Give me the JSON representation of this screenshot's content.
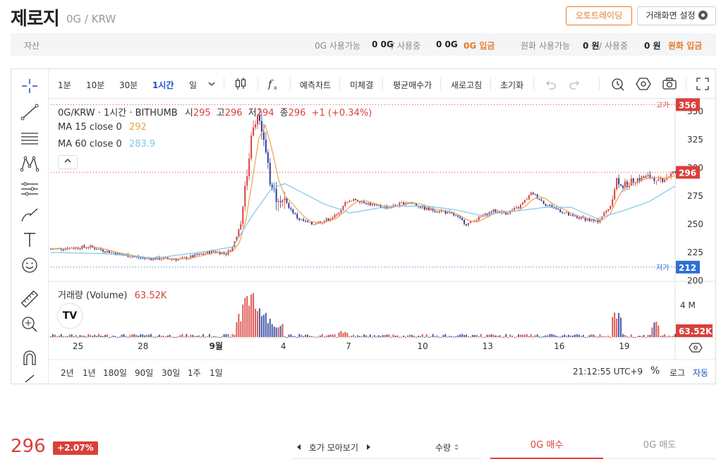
{
  "header": {
    "coin_name": "제로지",
    "pair": "0G / KRW",
    "auto_trading": "오토트레이딩",
    "screen_settings": "거래화면 설정"
  },
  "asset_bar": {
    "label": "자산",
    "coin_available_label": "0G 사용가능",
    "coin_available": "0 0G",
    "in_use_label": "/ 사용중",
    "coin_in_use": "0 0G",
    "deposit_coin": "0G 입금",
    "krw_available_label": "원화 사용가능",
    "krw_available": "0 원",
    "krw_in_use": "0 원",
    "deposit_krw": "원화 입금"
  },
  "toolbar": {
    "intervals": [
      "1분",
      "10분",
      "30분",
      "1시간",
      "일"
    ],
    "active_interval": "1시간",
    "buttons": [
      "예측차트",
      "미체결",
      "평균매수가",
      "새로고침",
      "초기화"
    ]
  },
  "legend": {
    "symbol_line": "0G/KRW · 1시간 · BITHUMB",
    "open_label": "시",
    "open": "295",
    "high_label": "고",
    "high": "296",
    "low_label": "저",
    "low": "294",
    "close_label": "종",
    "close": "296",
    "change": "+1 (+0.34%)",
    "ma15_label": "MA 15 close 0",
    "ma15": "292",
    "ma60_label": "MA 60 close 0",
    "ma60": "283.9",
    "volume_label": "거래량 (Volume)",
    "volume": "63.52K"
  },
  "markers": {
    "high_label": "고가",
    "high_value": "356",
    "low_label": "저가",
    "low_value": "212",
    "current_value": "296",
    "volume_value": "63.52K"
  },
  "bottom_toolbar": {
    "ranges": [
      "2년",
      "1년",
      "180일",
      "90일",
      "30일",
      "1주",
      "1일"
    ],
    "time": "21:12:55 UTC+9",
    "percent": "%",
    "log": "로그",
    "auto": "자동"
  },
  "bottom": {
    "price": "296",
    "change_pct": "+2.07%",
    "orderbook_label": "호가 모아보기",
    "qty_label": "수량",
    "buy_tab": "0G 매수",
    "sell_tab": "0G 매도"
  },
  "colors": {
    "up": "#d9403a",
    "down": "#2a3e9e",
    "ma15": "#f0a050",
    "ma60": "#7cc8e8",
    "accent_orange": "#e87a2a",
    "low_marker": "#2f6fd6"
  },
  "chart_data": {
    "type": "candlestick",
    "y_ticks": [
      200,
      225,
      250,
      275,
      300,
      325,
      350
    ],
    "ylim": [
      200,
      360
    ],
    "volume_ticks": [
      "4 M"
    ],
    "x_tick_labels": [
      "25",
      "28",
      "9월",
      "4",
      "7",
      "10",
      "13",
      "16",
      "19"
    ],
    "close_path": [
      [
        0,
        228
      ],
      [
        6,
        230
      ],
      [
        10,
        224
      ],
      [
        14,
        220
      ],
      [
        20,
        219
      ],
      [
        25,
        226
      ],
      [
        27,
        224
      ],
      [
        28,
        230
      ],
      [
        29,
        248
      ],
      [
        30,
        285
      ],
      [
        31,
        338
      ],
      [
        32,
        352
      ],
      [
        33,
        318
      ],
      [
        34,
        280
      ],
      [
        36,
        270
      ],
      [
        38,
        255
      ],
      [
        40,
        250
      ],
      [
        42,
        253
      ],
      [
        44,
        258
      ],
      [
        45,
        268
      ],
      [
        47,
        272
      ],
      [
        50,
        266
      ],
      [
        52,
        265
      ],
      [
        55,
        270
      ],
      [
        58,
        263
      ],
      [
        60,
        262
      ],
      [
        62,
        258
      ],
      [
        64,
        250
      ],
      [
        66,
        256
      ],
      [
        68,
        262
      ],
      [
        70,
        260
      ],
      [
        72,
        265
      ],
      [
        74,
        278
      ],
      [
        76,
        268
      ],
      [
        78,
        263
      ],
      [
        80,
        257
      ],
      [
        82,
        255
      ],
      [
        84,
        252
      ],
      [
        86,
        266
      ],
      [
        87,
        290
      ],
      [
        88,
        284
      ],
      [
        90,
        290
      ],
      [
        92,
        292
      ],
      [
        94,
        290
      ],
      [
        96,
        296
      ]
    ],
    "ma60_path": [
      [
        0,
        225
      ],
      [
        8,
        224
      ],
      [
        16,
        220
      ],
      [
        24,
        226
      ],
      [
        28,
        230
      ],
      [
        31,
        258
      ],
      [
        34,
        282
      ],
      [
        36,
        286
      ],
      [
        38,
        280
      ],
      [
        42,
        268
      ],
      [
        46,
        260
      ],
      [
        52,
        266
      ],
      [
        58,
        266
      ],
      [
        62,
        263
      ],
      [
        66,
        258
      ],
      [
        72,
        262
      ],
      [
        76,
        265
      ],
      [
        80,
        265
      ],
      [
        84,
        255
      ],
      [
        88,
        262
      ],
      [
        92,
        270
      ],
      [
        96,
        284
      ]
    ],
    "volume_spikes": [
      [
        29,
        0.45
      ],
      [
        30,
        0.85
      ],
      [
        31,
        0.92
      ],
      [
        32,
        0.6
      ],
      [
        33,
        0.55
      ],
      [
        34,
        0.35
      ],
      [
        35,
        0.3
      ],
      [
        45,
        0.12
      ],
      [
        87,
        0.55
      ],
      [
        93,
        0.3
      ]
    ]
  }
}
